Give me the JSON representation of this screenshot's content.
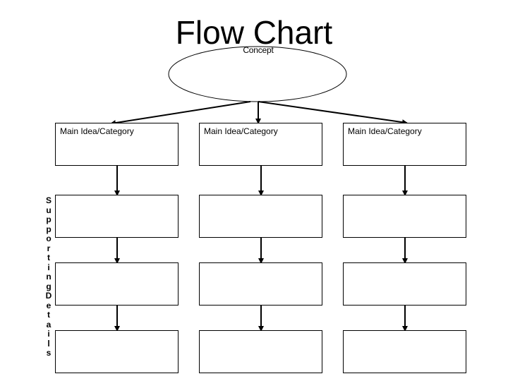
{
  "title": "Flow Chart",
  "concept": {
    "label": "Concept"
  },
  "columns": [
    {
      "header": "Main Idea/Category",
      "details": [
        "",
        "",
        ""
      ]
    },
    {
      "header": "Main Idea/Category",
      "details": [
        "",
        "",
        ""
      ]
    },
    {
      "header": "Main Idea/Category",
      "details": [
        "",
        "",
        ""
      ]
    }
  ],
  "side_label": "SupportingDetails",
  "colors": {
    "stroke": "#000000",
    "background": "#ffffff"
  }
}
